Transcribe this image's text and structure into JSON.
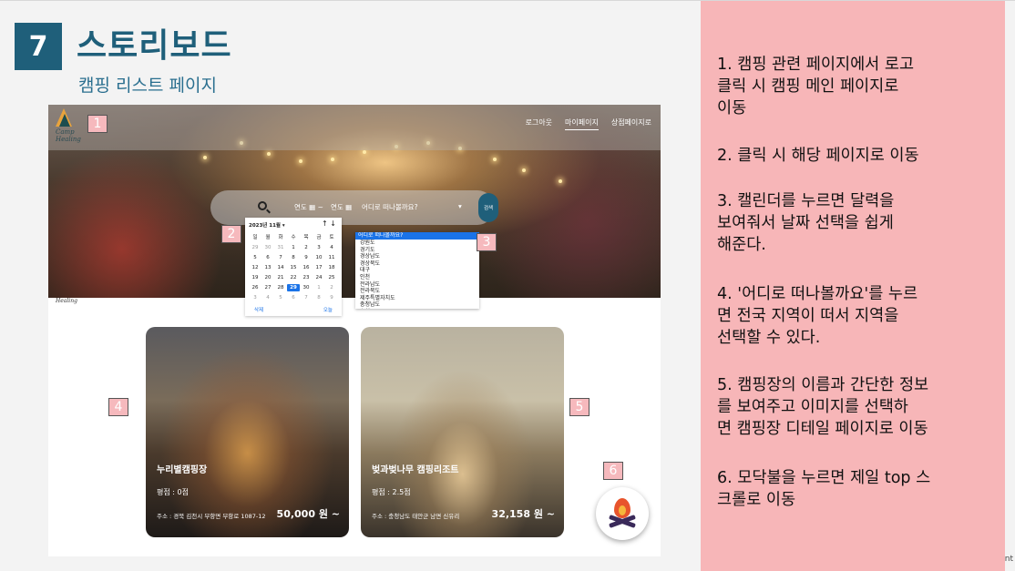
{
  "slide": {
    "number": "7",
    "title": "스토리보드",
    "subtitle": "캠핑 리스트 페이지"
  },
  "screenshot": {
    "logo": {
      "line1": "Camp",
      "line2": "Healing"
    },
    "nav": [
      "로그아웃",
      "마이페이지",
      "상점페이지로"
    ],
    "search": {
      "checkin": "연도 ▦ ~",
      "checkout": "연도 ▦",
      "region": "어디로 떠나볼까요?",
      "button": "검색"
    },
    "calendar": {
      "header": "2023년 11월 ▾",
      "arrows": "↑ ↓",
      "weekdays": [
        "일",
        "월",
        "화",
        "수",
        "목",
        "금",
        "토"
      ],
      "days": [
        "29",
        "30",
        "31",
        "1",
        "2",
        "3",
        "4",
        "5",
        "6",
        "7",
        "8",
        "9",
        "10",
        "11",
        "12",
        "13",
        "14",
        "15",
        "16",
        "17",
        "18",
        "19",
        "20",
        "21",
        "22",
        "23",
        "24",
        "25",
        "26",
        "27",
        "28",
        "29",
        "30",
        "1",
        "2",
        "3",
        "4",
        "5",
        "6",
        "7",
        "8",
        "9"
      ],
      "selected_day": "29",
      "clear": "삭제",
      "today": "오늘"
    },
    "regions": [
      "어디로 떠나볼까요?",
      "강원도",
      "경기도",
      "경상남도",
      "경상북도",
      "대구",
      "인천",
      "전라남도",
      "전라북도",
      "제주특별자치도",
      "충청남도",
      "충청북도"
    ],
    "healing_tag": "Healing",
    "cards": [
      {
        "name": "누리별캠핑장",
        "rating": "평점 : 0점",
        "address": "주소 : 경북 김천시 부항면 부항로 1087-12",
        "price": "50,000 원 ~"
      },
      {
        "name": "벚과벚나무 캠핑리조트",
        "rating": "평점 : 2.5점",
        "address": "주소 : 충청남도 태안군 남면 신유리",
        "price": "32,158 원 ~"
      }
    ]
  },
  "markers": [
    "1",
    "2",
    "3",
    "4",
    "5",
    "6"
  ],
  "notes": [
    "1. 캠핑 관련 페이지에서 로고\n   클릭 시 캠핑 메인 페이지로\n   이동",
    "2. 클릭 시 해당 페이지로 이동",
    "3.  캘린더를 누르면 달력을\n   보여줘서 날짜 선택을 쉽게\n   해준다.",
    "4. '어디로 떠나볼까요'를 누르\n   면 전국 지역이 떠서 지역을\n   선택할 수 있다.",
    "5.  캠핑장의 이름과 간단한 정보\n를 보여주고 이미지를 선택하\n면 캠핑장 디테일 페이지로 이동",
    "6.  모닥불을 누르면 제일 top 스\n크롤로 이동"
  ],
  "edge_char": "nt"
}
